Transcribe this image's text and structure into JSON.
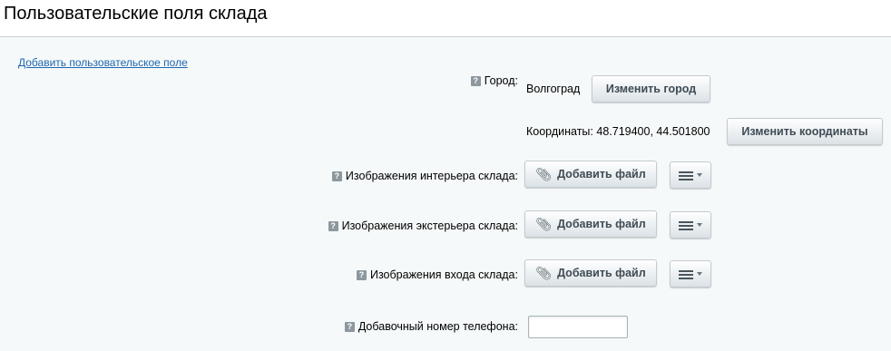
{
  "header": {
    "title": "Пользовательские поля склада"
  },
  "add_field_link": "Добавить пользовательское поле",
  "help_icon_glyph": "?",
  "fields": {
    "city": {
      "label": "Город:",
      "value": "Волгоград",
      "button": "Изменить город"
    },
    "coordinates": {
      "text": "Координаты: 48.719400, 44.501800",
      "button": "Изменить координаты"
    },
    "interior_images": {
      "label": "Изображения интерьера склада:",
      "button": "Добавить файл"
    },
    "exterior_images": {
      "label": "Изображения экстерьера склада:",
      "button": "Добавить файл"
    },
    "entrance_images": {
      "label": "Изображения входа склада:",
      "button": "Добавить файл"
    },
    "extension_phone": {
      "label": "Добавочный номер телефона:",
      "value": ""
    }
  },
  "icons": {
    "help": "question-mark-square",
    "attach": "paperclip",
    "menu": "hamburger-with-caret"
  },
  "colors": {
    "background": "#f5f9f9",
    "link": "#2067b0",
    "button_text": "#3f4b54"
  }
}
